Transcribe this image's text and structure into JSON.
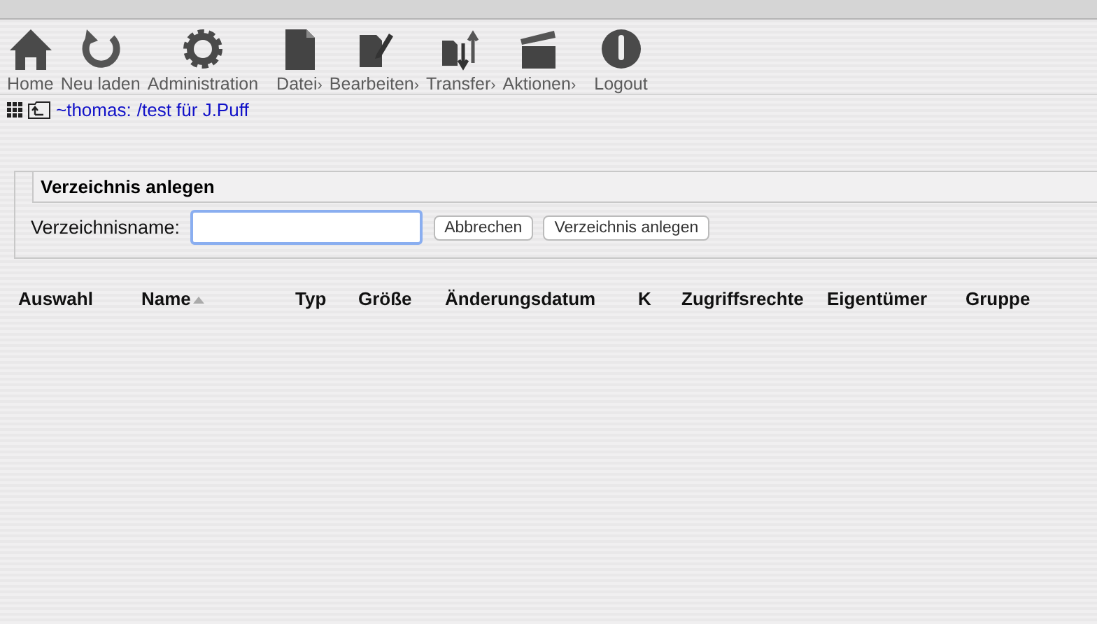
{
  "toolbar": [
    {
      "kind": "home",
      "label": "Home"
    },
    {
      "kind": "reload",
      "label": "Neu laden"
    },
    {
      "kind": "gear",
      "label": "Administration"
    },
    {
      "kind": "file",
      "label": "Datei",
      "arrow": "›"
    },
    {
      "kind": "edit",
      "label": "Bearbeiten",
      "arrow": "›"
    },
    {
      "kind": "transfer",
      "label": "Transfer",
      "arrow": "›"
    },
    {
      "kind": "clapper",
      "label": "Aktionen",
      "arrow": "›"
    },
    {
      "kind": "power",
      "label": "Logout"
    }
  ],
  "breadcrumb": {
    "home": "~thomas",
    "separator": ":",
    "path": "/test für J.Puff"
  },
  "form": {
    "legend": "Verzeichnis anlegen",
    "label": "Verzeichnisname:",
    "buttons": [
      "Abbrechen",
      "Verzeichnis anlegen"
    ]
  },
  "table": {
    "columns": [
      {
        "label": "Auswahl",
        "sorted": false
      },
      {
        "label": "Name",
        "sorted": true
      },
      {
        "label": "Typ",
        "sorted": false
      },
      {
        "label": "Größe",
        "sorted": false
      },
      {
        "label": "Änderungsdatum",
        "sorted": false
      },
      {
        "label": "K",
        "sorted": false
      },
      {
        "label": "Zugriffsrechte",
        "sorted": false
      },
      {
        "label": "Eigentümer",
        "sorted": false
      },
      {
        "label": "Gruppe",
        "sorted": false
      }
    ]
  }
}
